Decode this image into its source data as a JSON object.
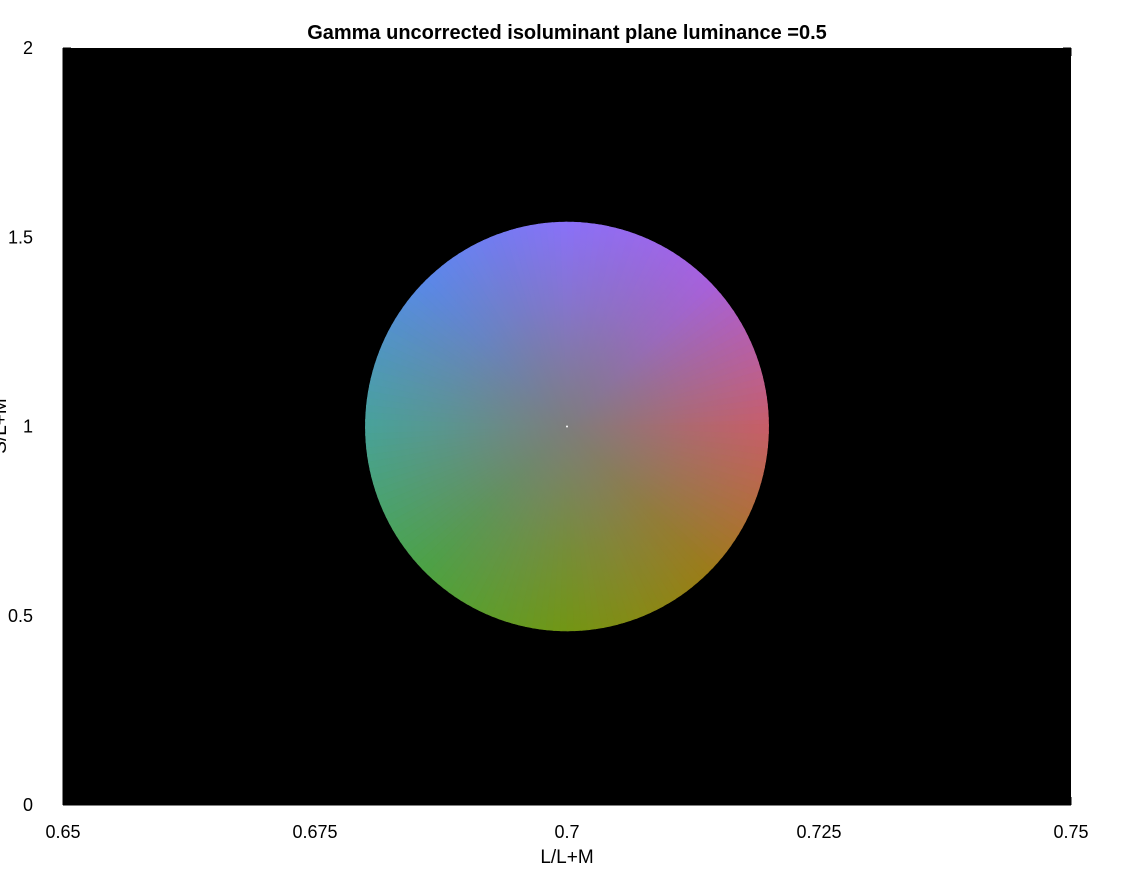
{
  "chart_data": {
    "type": "heatmap",
    "title": "Gamma uncorrected isoluminant plane luminance =0.5",
    "xlabel": "L/L+M",
    "ylabel": "S/L+M",
    "xlim": [
      0.65,
      0.75
    ],
    "ylim": [
      0,
      2
    ],
    "xticks": [
      0.65,
      0.675,
      0.7,
      0.725,
      0.75
    ],
    "xtick_labels": [
      "0.65",
      "0.675",
      "0.7",
      "0.725",
      "0.75"
    ],
    "yticks": [
      0,
      0.5,
      1,
      1.5,
      2
    ],
    "ytick_labels": [
      "0",
      "0.5",
      "1",
      "1.5",
      "2"
    ],
    "background_color": "#000000",
    "grid": false,
    "disc": {
      "center": [
        0.7,
        1.0
      ],
      "radius_x": 0.02,
      "radius_y": 0.54,
      "center_color": "#7d7d7d",
      "color_samples": [
        {
          "direction": "top",
          "color": "#8a70f8"
        },
        {
          "direction": "top-right",
          "color": "#a860dc"
        },
        {
          "direction": "right",
          "color": "#c85e68"
        },
        {
          "direction": "bottom-right",
          "color": "#9c7c18"
        },
        {
          "direction": "bottom",
          "color": "#729614"
        },
        {
          "direction": "bottom-left",
          "color": "#4ca244"
        },
        {
          "direction": "left",
          "color": "#48a29a"
        },
        {
          "direction": "top-left",
          "color": "#5a88e8"
        }
      ]
    }
  }
}
